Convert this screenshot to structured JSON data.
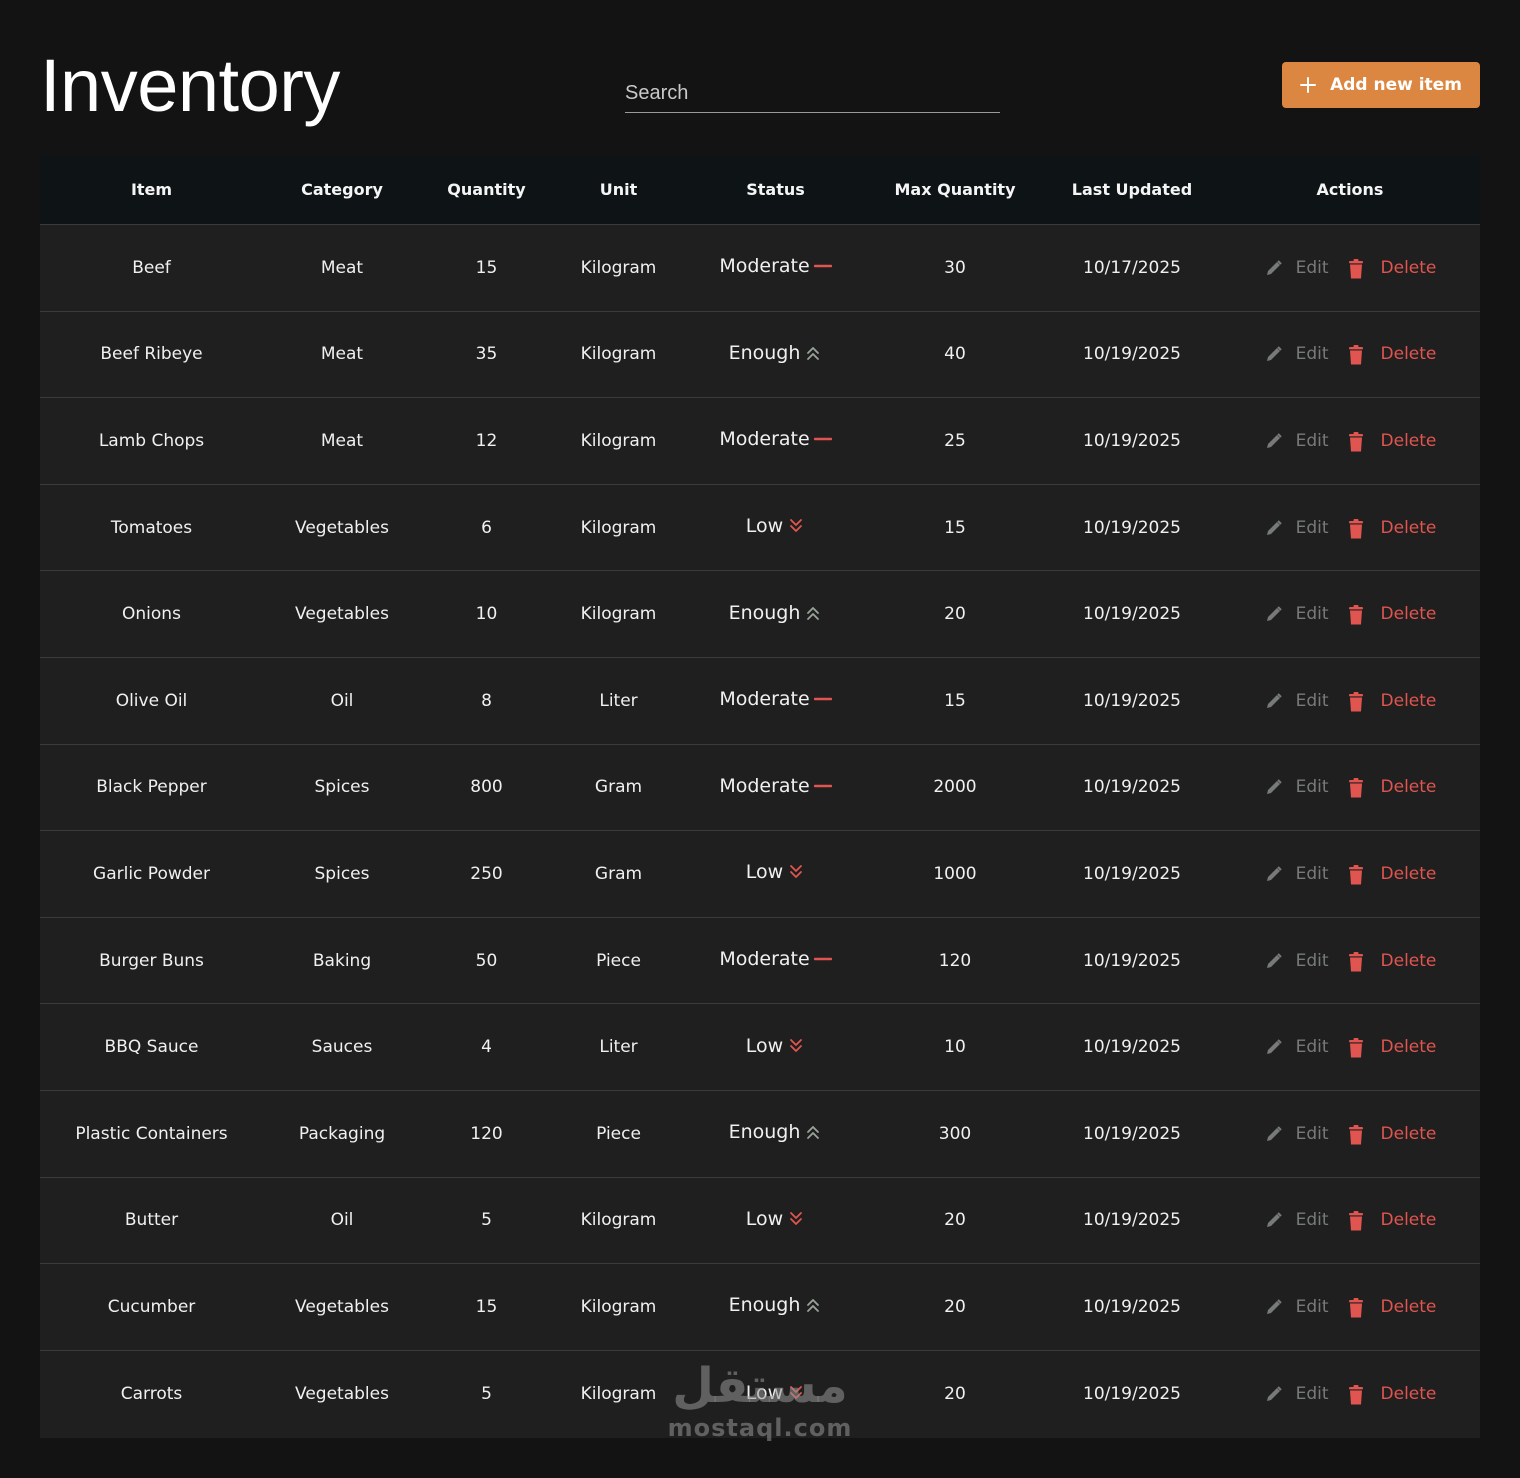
{
  "header": {
    "title": "Inventory",
    "search_placeholder": "Search",
    "add_button_label": "Add new item"
  },
  "colors": {
    "accent": "#dc8741",
    "status_moderate": "#e0554f",
    "status_low": "#e0554f",
    "status_enough": "#9aa39a",
    "delete": "#e0554f",
    "edit": "#777b77"
  },
  "table": {
    "columns": [
      "Item",
      "Category",
      "Quantity",
      "Unit",
      "Status",
      "Max Quantity",
      "Last Updated",
      "Actions"
    ],
    "edit_label": "Edit",
    "delete_label": "Delete",
    "rows": [
      {
        "item": "Beef",
        "category": "Meat",
        "quantity": "15",
        "unit": "Kilogram",
        "status": "Moderate",
        "status_icon": "dash-icon",
        "max": "30",
        "updated": "10/17/2025"
      },
      {
        "item": "Beef Ribeye",
        "category": "Meat",
        "quantity": "35",
        "unit": "Kilogram",
        "status": "Enough",
        "status_icon": "double-chevron-up-icon",
        "max": "40",
        "updated": "10/19/2025"
      },
      {
        "item": "Lamb Chops",
        "category": "Meat",
        "quantity": "12",
        "unit": "Kilogram",
        "status": "Moderate",
        "status_icon": "dash-icon",
        "max": "25",
        "updated": "10/19/2025"
      },
      {
        "item": "Tomatoes",
        "category": "Vegetables",
        "quantity": "6",
        "unit": "Kilogram",
        "status": "Low",
        "status_icon": "double-chevron-down-icon",
        "max": "15",
        "updated": "10/19/2025"
      },
      {
        "item": "Onions",
        "category": "Vegetables",
        "quantity": "10",
        "unit": "Kilogram",
        "status": "Enough",
        "status_icon": "double-chevron-up-icon",
        "max": "20",
        "updated": "10/19/2025"
      },
      {
        "item": "Olive Oil",
        "category": "Oil",
        "quantity": "8",
        "unit": "Liter",
        "status": "Moderate",
        "status_icon": "dash-icon",
        "max": "15",
        "updated": "10/19/2025"
      },
      {
        "item": "Black Pepper",
        "category": "Spices",
        "quantity": "800",
        "unit": "Gram",
        "status": "Moderate",
        "status_icon": "dash-icon",
        "max": "2000",
        "updated": "10/19/2025"
      },
      {
        "item": "Garlic Powder",
        "category": "Spices",
        "quantity": "250",
        "unit": "Gram",
        "status": "Low",
        "status_icon": "double-chevron-down-icon",
        "max": "1000",
        "updated": "10/19/2025"
      },
      {
        "item": "Burger Buns",
        "category": "Baking",
        "quantity": "50",
        "unit": "Piece",
        "status": "Moderate",
        "status_icon": "dash-icon",
        "max": "120",
        "updated": "10/19/2025"
      },
      {
        "item": "BBQ Sauce",
        "category": "Sauces",
        "quantity": "4",
        "unit": "Liter",
        "status": "Low",
        "status_icon": "double-chevron-down-icon",
        "max": "10",
        "updated": "10/19/2025"
      },
      {
        "item": "Plastic Containers",
        "category": "Packaging",
        "quantity": "120",
        "unit": "Piece",
        "status": "Enough",
        "status_icon": "double-chevron-up-icon",
        "max": "300",
        "updated": "10/19/2025"
      },
      {
        "item": "Butter",
        "category": "Oil",
        "quantity": "5",
        "unit": "Kilogram",
        "status": "Low",
        "status_icon": "double-chevron-down-icon",
        "max": "20",
        "updated": "10/19/2025"
      },
      {
        "item": "Cucumber",
        "category": "Vegetables",
        "quantity": "15",
        "unit": "Kilogram",
        "status": "Enough",
        "status_icon": "double-chevron-up-icon",
        "max": "20",
        "updated": "10/19/2025"
      },
      {
        "item": "Carrots",
        "category": "Vegetables",
        "quantity": "5",
        "unit": "Kilogram",
        "status": "Low",
        "status_icon": "double-chevron-down-icon",
        "max": "20",
        "updated": "10/19/2025"
      }
    ]
  },
  "watermark": {
    "arabic": "مستقل",
    "latin": "mostaql.com"
  }
}
